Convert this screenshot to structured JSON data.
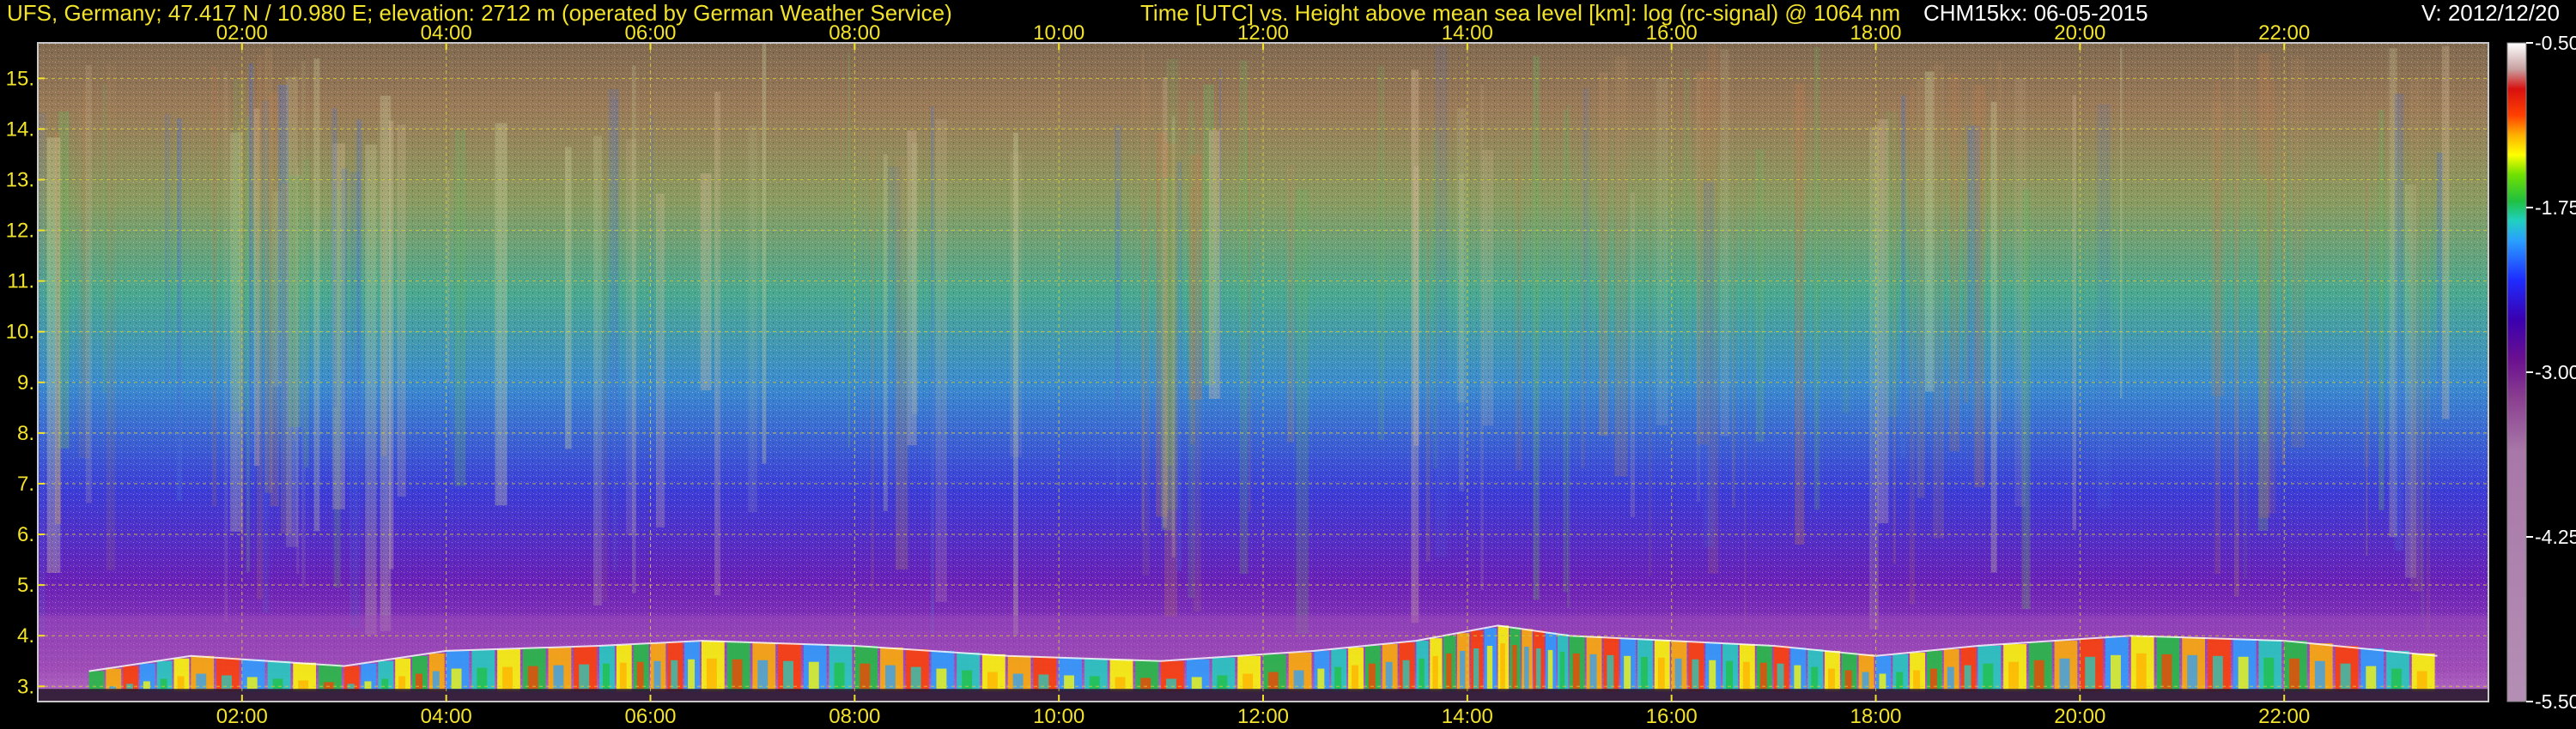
{
  "header": {
    "station": "UFS, Germany; 47.417 N / 10.980 E; elevation: 2712 m  (operated by German Weather Service)",
    "title": "Time [UTC] vs. Height above mean sea level [km]: log (rc-signal) @ 1064 nm",
    "instrument_date": "CHM15kx: 06-05-2015",
    "version": "V: 2012/12/20"
  },
  "colors": {
    "text_yellow": "#f2e22a",
    "text_white": "#ffffff",
    "plot_border": "#c8c8c8",
    "grid": "#d8cf3a"
  },
  "chart_data": {
    "type": "heatmap",
    "title": "Time [UTC] vs. Height above mean sea level [km]: log (rc-signal) @ 1064 nm",
    "xlabel": "Time [UTC]",
    "ylabel": "Height above mean sea level [km]",
    "xlim": [
      0.0,
      24.0
    ],
    "ylim": [
      2.7,
      15.7
    ],
    "x_ticks": [
      {
        "value": 2,
        "label": "02:00"
      },
      {
        "value": 4,
        "label": "04:00"
      },
      {
        "value": 6,
        "label": "06:00"
      },
      {
        "value": 8,
        "label": "08:00"
      },
      {
        "value": 10,
        "label": "10:00"
      },
      {
        "value": 12,
        "label": "12:00"
      },
      {
        "value": 14,
        "label": "14:00"
      },
      {
        "value": 16,
        "label": "16:00"
      },
      {
        "value": 18,
        "label": "18:00"
      },
      {
        "value": 20,
        "label": "20:00"
      },
      {
        "value": 22,
        "label": "22:00"
      }
    ],
    "y_ticks": [
      {
        "value": 3,
        "label": "3."
      },
      {
        "value": 4,
        "label": "4."
      },
      {
        "value": 5,
        "label": "5."
      },
      {
        "value": 6,
        "label": "6."
      },
      {
        "value": 7,
        "label": "7."
      },
      {
        "value": 8,
        "label": "8."
      },
      {
        "value": 9,
        "label": "9."
      },
      {
        "value": 10,
        "label": "10."
      },
      {
        "value": 11,
        "label": "11."
      },
      {
        "value": 12,
        "label": "12."
      },
      {
        "value": 13,
        "label": "13."
      },
      {
        "value": 14,
        "label": "14."
      },
      {
        "value": 15,
        "label": "15."
      }
    ],
    "grid": true,
    "colorbar": {
      "min": -5.5,
      "max": -0.5,
      "ticks": [
        {
          "value": -0.5,
          "label": "-0.50"
        },
        {
          "value": -1.75,
          "label": "-1.75"
        },
        {
          "value": -3.0,
          "label": "-3.00"
        },
        {
          "value": -4.25,
          "label": "-4.25"
        },
        {
          "value": -5.5,
          "label": "-5.50"
        }
      ],
      "stops": [
        {
          "value": -5.5,
          "color": "#b48fb4"
        },
        {
          "value": -3.6,
          "color": "#a878a8"
        },
        {
          "value": -3.2,
          "color": "#8a3f90"
        },
        {
          "value": -2.9,
          "color": "#6a1090"
        },
        {
          "value": -2.6,
          "color": "#3a00b0"
        },
        {
          "value": -2.3,
          "color": "#1e2cff"
        },
        {
          "value": -2.0,
          "color": "#2aa0ff"
        },
        {
          "value": -1.85,
          "color": "#20d0c0"
        },
        {
          "value": -1.7,
          "color": "#20c040"
        },
        {
          "value": -1.5,
          "color": "#70e000"
        },
        {
          "value": -1.35,
          "color": "#ffff00"
        },
        {
          "value": -1.2,
          "color": "#ffb000"
        },
        {
          "value": -1.05,
          "color": "#ff4000"
        },
        {
          "value": -0.85,
          "color": "#d81010"
        },
        {
          "value": -0.7,
          "color": "#c8a0a0"
        },
        {
          "value": -0.5,
          "color": "#ffffff"
        }
      ]
    },
    "boundary_layer_top_km": [
      {
        "t": 0.5,
        "h": 3.3
      },
      {
        "t": 1.5,
        "h": 3.6
      },
      {
        "t": 3.0,
        "h": 3.4
      },
      {
        "t": 4.0,
        "h": 3.7
      },
      {
        "t": 5.5,
        "h": 3.8
      },
      {
        "t": 6.5,
        "h": 3.9
      },
      {
        "t": 8.0,
        "h": 3.8
      },
      {
        "t": 9.5,
        "h": 3.6
      },
      {
        "t": 11.0,
        "h": 3.5
      },
      {
        "t": 12.5,
        "h": 3.7
      },
      {
        "t": 13.5,
        "h": 3.9
      },
      {
        "t": 14.3,
        "h": 4.2
      },
      {
        "t": 15.0,
        "h": 4.0
      },
      {
        "t": 16.0,
        "h": 3.9
      },
      {
        "t": 17.0,
        "h": 3.8
      },
      {
        "t": 18.0,
        "h": 3.6
      },
      {
        "t": 19.0,
        "h": 3.8
      },
      {
        "t": 20.5,
        "h": 4.0
      },
      {
        "t": 22.0,
        "h": 3.9
      },
      {
        "t": 23.5,
        "h": 3.6
      }
    ]
  }
}
